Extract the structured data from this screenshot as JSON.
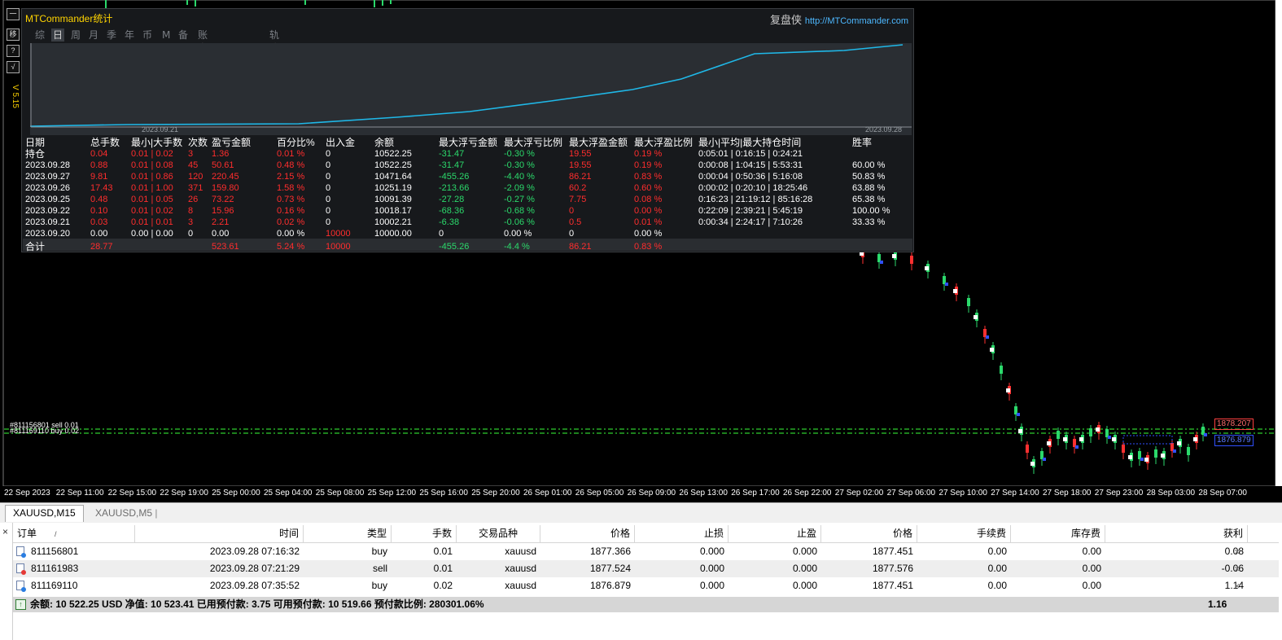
{
  "panel": {
    "title": "MTCommander统计",
    "brand_cn": "复盘侠",
    "brand_url": "http://MTCommander.com",
    "version": "V 5.15",
    "tabs": [
      "综",
      "日",
      "周",
      "月",
      "季",
      "年",
      "币",
      "M",
      "备",
      "账户",
      "轨迹"
    ],
    "active_tab": "日",
    "equity_dates": [
      "2023.09.21",
      "2023.09.28"
    ],
    "table_headers": [
      "日期",
      "总手数",
      "最小|大手数",
      "次数",
      "盈亏金额",
      "百分比%",
      "出入金",
      "余额",
      "最大浮亏金额",
      "最大浮亏比例",
      "最大浮盈金额",
      "最大浮盈比例",
      "最小|平均|最大持仓时间",
      "胜率"
    ],
    "rows": [
      [
        "持仓",
        "0.04",
        "0.01 | 0.02",
        "3",
        "1.36",
        "0.01 %",
        "0",
        "10522.25",
        "-31.47",
        "-0.30 %",
        "19.55",
        "0.19 %",
        "0:05:01 | 0:16:15 | 0:24:21",
        ""
      ],
      [
        "2023.09.28",
        "0.88",
        "0.01 | 0.08",
        "45",
        "50.61",
        "0.48 %",
        "0",
        "10522.25",
        "-31.47",
        "-0.30 %",
        "19.55",
        "0.19 %",
        "0:00:08 | 1:04:15 | 5:53:31",
        "60.00 %"
      ],
      [
        "2023.09.27",
        "9.81",
        "0.01 | 0.86",
        "120",
        "220.45",
        "2.15 %",
        "0",
        "10471.64",
        "-455.26",
        "-4.40 %",
        "86.21",
        "0.83 %",
        "0:00:04 | 0:50:36 | 5:16:08",
        "50.83 %"
      ],
      [
        "2023.09.26",
        "17.43",
        "0.01 | 1.00",
        "371",
        "159.80",
        "1.58 %",
        "0",
        "10251.19",
        "-213.66",
        "-2.09 %",
        "60.2",
        "0.60 %",
        "0:00:02 | 0:20:10 | 18:25:46",
        "63.88 %"
      ],
      [
        "2023.09.25",
        "0.48",
        "0.01 | 0.05",
        "26",
        "73.22",
        "0.73 %",
        "0",
        "10091.39",
        "-27.28",
        "-0.27 %",
        "7.75",
        "0.08 %",
        "0:16:23 | 21:19:12 | 85:16:28",
        "65.38 %"
      ],
      [
        "2023.09.22",
        "0.10",
        "0.01 | 0.02",
        "8",
        "15.96",
        "0.16 %",
        "0",
        "10018.17",
        "-68.36",
        "-0.68 %",
        "0",
        "0.00 %",
        "0:22:09 | 2:39:21 | 5:45:19",
        "100.00 %"
      ],
      [
        "2023.09.21",
        "0.03",
        "0.01 | 0.01",
        "3",
        "2.21",
        "0.02 %",
        "0",
        "10002.21",
        "-6.38",
        "-0.06 %",
        "0.5",
        "0.01 %",
        "0:00:34 | 2:24:17 | 7:10:26",
        "33.33 %"
      ],
      [
        "2023.09.20",
        "0.00",
        "0.00 | 0.00",
        "0",
        "0.00",
        "0.00 %",
        "10000",
        "10000.00",
        "0",
        "0.00 %",
        "0",
        "0.00 %",
        "",
        ""
      ]
    ],
    "total_row": [
      "合计",
      "28.77",
      "",
      "",
      "523.61",
      "5.24 %",
      "10000",
      "",
      "-455.26",
      "-4.4 %",
      "86.21",
      "0.83 %",
      "",
      ""
    ],
    "colors": {
      "line": "#1fb8e8",
      "red": "#ff2d2d",
      "green": "#2bd96b",
      "title": "#ffd400"
    }
  },
  "side_buttons": [
    "一",
    "移",
    "?",
    "√"
  ],
  "chart": {
    "order_labels": [
      "#811156801 sell 0.01",
      "#811169110 buy 0.02"
    ],
    "price_tags": [
      "1878.207",
      "1876.879"
    ],
    "time_axis": [
      "22 Sep 2023",
      "22 Sep 11:00",
      "22 Sep 15:00",
      "22 Sep 19:00",
      "25 Sep 00:00",
      "25 Sep 04:00",
      "25 Sep 08:00",
      "25 Sep 12:00",
      "25 Sep 16:00",
      "25 Sep 20:00",
      "26 Sep 01:00",
      "26 Sep 05:00",
      "26 Sep 09:00",
      "26 Sep 13:00",
      "26 Sep 17:00",
      "26 Sep 22:00",
      "27 Sep 02:00",
      "27 Sep 06:00",
      "27 Sep 10:00",
      "27 Sep 14:00",
      "27 Sep 18:00",
      "27 Sep 23:00",
      "28 Sep 03:00",
      "28 Sep 07:00"
    ]
  },
  "symbol_tabs": [
    "XAUUSD,M15",
    "XAUUSD,M5"
  ],
  "trade_table": {
    "close_label": "×",
    "headers": [
      "订单",
      "时间",
      "类型",
      "手数",
      "交易品种",
      "价格",
      "止损",
      "止盈",
      "价格",
      "手续费",
      "库存费",
      "获利"
    ],
    "sort_mark": "/",
    "rows": [
      {
        "type": "buy",
        "cells": [
          "811156801",
          "2023.09.28 07:16:32",
          "buy",
          "0.01",
          "xauusd",
          "1877.366",
          "0.000",
          "0.000",
          "1877.451",
          "0.00",
          "0.00",
          "0.08"
        ]
      },
      {
        "type": "sell",
        "cells": [
          "811161983",
          "2023.09.28 07:21:29",
          "sell",
          "0.01",
          "xauusd",
          "1877.524",
          "0.000",
          "0.000",
          "1877.576",
          "0.00",
          "0.00",
          "-0.06"
        ]
      },
      {
        "type": "buy",
        "cells": [
          "811169110",
          "2023.09.28 07:35:52",
          "buy",
          "0.02",
          "xauusd",
          "1876.879",
          "0.000",
          "0.000",
          "1877.451",
          "0.00",
          "0.00",
          "1.14"
        ]
      }
    ],
    "summary": "余额: 10 522.25 USD  净值: 10 523.41  已用预付款: 3.75  可用预付款: 10 519.66  预付款比例: 280301.06%",
    "summary_profit": "1.16"
  }
}
